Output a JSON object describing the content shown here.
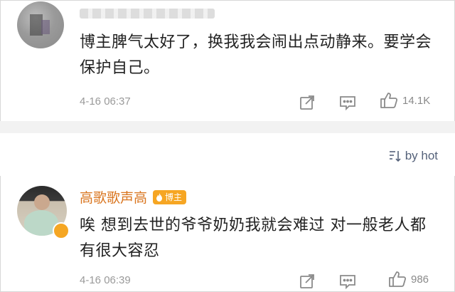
{
  "comments": [
    {
      "text": "博主脾气太好了，换我我会闹出点动静来。要学会保护自己。",
      "time": "4-16 06:37",
      "likes": "14.1K"
    },
    {
      "username": "高歌歌声高",
      "badge": "博主",
      "text": "唉 想到去世的爷爷奶奶我就会难过 对一般老人都有很大容忍",
      "time": "4-16 06:39",
      "likes": "986"
    }
  ],
  "sort": {
    "label": "by hot"
  },
  "colors": {
    "username": "#d9751f",
    "badge_bg": "#f6a623",
    "sort_text": "#55627a",
    "meta_gray": "#9a9a9a"
  },
  "icons": [
    "share-icon",
    "reply-icon",
    "like-icon",
    "sort-icon",
    "verified-icon",
    "fire-icon"
  ]
}
